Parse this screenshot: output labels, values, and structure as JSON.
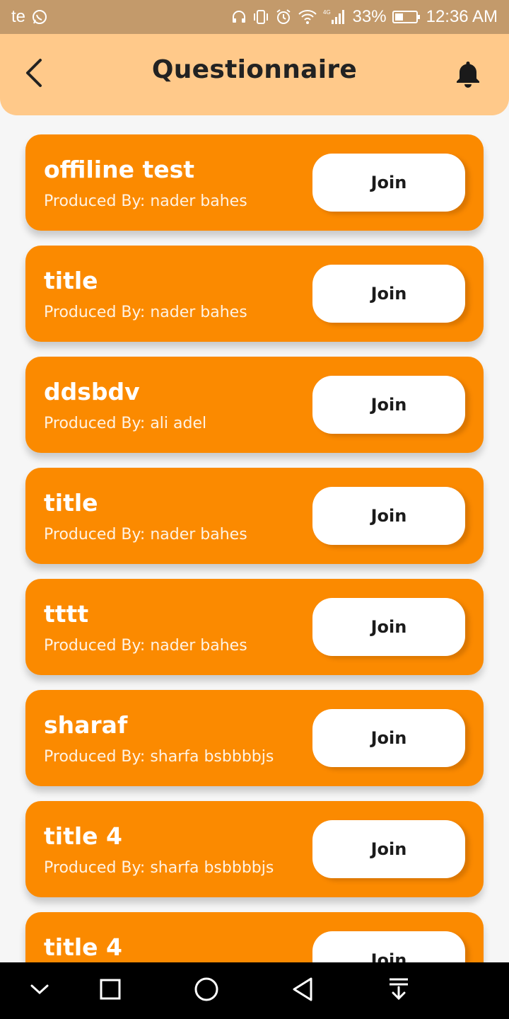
{
  "status_bar": {
    "carrier": "te",
    "battery": "33%",
    "time": "12:36 AM",
    "network": "4G",
    "icons": [
      "whatsapp-icon",
      "headphones-icon",
      "vibrate-icon",
      "alarm-icon",
      "wifi-icon",
      "signal-icon",
      "battery-icon"
    ]
  },
  "header": {
    "title": "Questionnaire",
    "back_icon": "chevron-left-icon",
    "notification_icon": "bell-icon"
  },
  "questionnaires": [
    {
      "title": "offiline test",
      "producer": "Produced By: nader bahes",
      "action": "Join"
    },
    {
      "title": "title",
      "producer": "Produced By: nader bahes",
      "action": "Join"
    },
    {
      "title": "ddsbdv",
      "producer": "Produced By: ali adel",
      "action": "Join"
    },
    {
      "title": "title",
      "producer": "Produced By: nader bahes",
      "action": "Join"
    },
    {
      "title": "tttt",
      "producer": "Produced By: nader bahes",
      "action": "Join"
    },
    {
      "title": "sharaf",
      "producer": "Produced By: sharfa bsbbbbjs",
      "action": "Join"
    },
    {
      "title": "title 4",
      "producer": "Produced By: sharfa bsbbbbjs",
      "action": "Join"
    },
    {
      "title": "title 4",
      "producer": "",
      "action": "Join"
    }
  ],
  "nav_bar": {
    "buttons": [
      "chevron-down-icon",
      "square-icon",
      "circle-icon",
      "triangle-back-icon",
      "download-icon"
    ]
  },
  "colors": {
    "status_bar": "#c39a6b",
    "header": "#ffc98a",
    "card": "#fb8a00",
    "button": "#ffffff",
    "background": "#f6f6f6"
  }
}
